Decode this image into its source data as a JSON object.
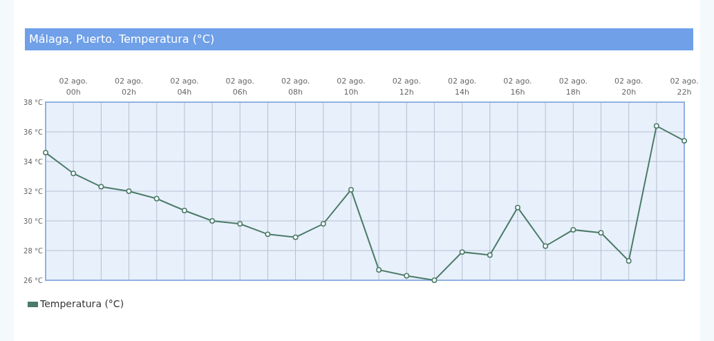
{
  "title": "Málaga, Puerto. Temperatura (°C)",
  "chart_data": {
    "type": "line",
    "grid": true,
    "categories": [
      null,
      "02 ago. 00h",
      null,
      "02 ago. 02h",
      null,
      "02 ago. 04h",
      null,
      "02 ago. 06h",
      null,
      "02 ago. 08h",
      null,
      "02 ago. 10h",
      null,
      "02 ago. 12h",
      null,
      "02 ago. 14h",
      null,
      "02 ago. 16h",
      null,
      "02 ago. 18h",
      null,
      "02 ago. 20h",
      null,
      "02 ago. 22h"
    ],
    "series": [
      {
        "name": "Temperatura (°C)",
        "color": "#4a7a68",
        "marker": true,
        "values": [
          34.6,
          33.2,
          32.3,
          32.0,
          31.5,
          30.7,
          30.0,
          29.8,
          29.1,
          28.9,
          29.8,
          32.1,
          26.7,
          26.3,
          26.0,
          27.9,
          27.7,
          30.9,
          28.3,
          29.4,
          29.2,
          27.3,
          36.4,
          35.4
        ]
      }
    ],
    "ylim": [
      26,
      38
    ],
    "yticks": [
      {
        "value": 26,
        "label": "26 °C"
      },
      {
        "value": 28,
        "label": "28 °C"
      },
      {
        "value": 30,
        "label": "30 °C"
      },
      {
        "value": 32,
        "label": "32 °C"
      },
      {
        "value": 34,
        "label": "34 °C"
      },
      {
        "value": 36,
        "label": "36 °C"
      },
      {
        "value": 38,
        "label": "38 °C"
      }
    ]
  }
}
